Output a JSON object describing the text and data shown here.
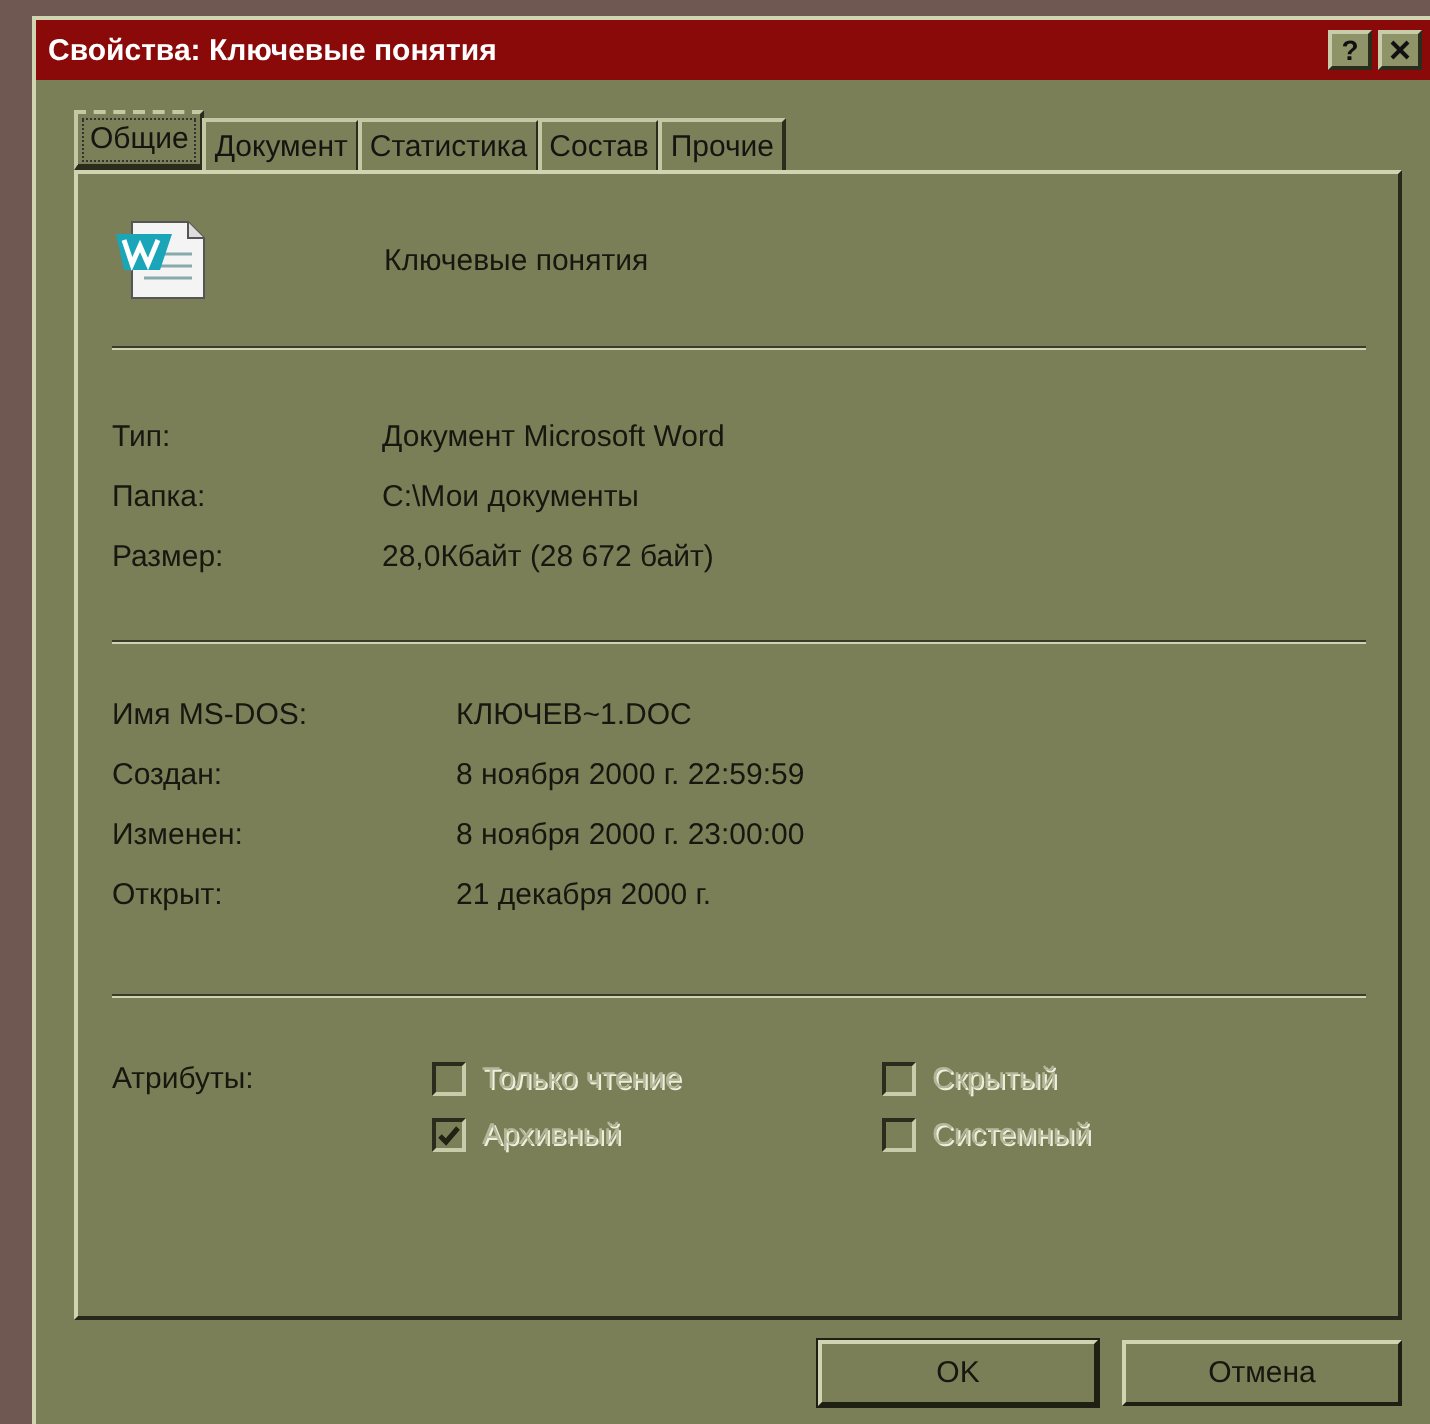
{
  "window": {
    "title": "Свойства: Ключевые понятия",
    "help_button": "?"
  },
  "tabs": [
    {
      "label": "Общие",
      "selected": true
    },
    {
      "label": "Документ",
      "selected": false
    },
    {
      "label": "Статистика",
      "selected": false
    },
    {
      "label": "Состав",
      "selected": false
    },
    {
      "label": "Прочие",
      "selected": false
    }
  ],
  "file": {
    "name": "Ключевые понятия"
  },
  "details": [
    {
      "label": "Тип:",
      "value": "Документ Microsoft Word"
    },
    {
      "label": "Папка:",
      "value": "C:\\Мои документы"
    },
    {
      "label": "Размер:",
      "value": "28,0Кбайт (28 672 байт)"
    }
  ],
  "dos_details": [
    {
      "label": "Имя MS-DOS:",
      "value": "КЛЮЧЕВ~1.DOC"
    },
    {
      "label": "Создан:",
      "value": "8 ноября 2000 г. 22:59:59"
    },
    {
      "label": "Изменен:",
      "value": "8 ноября 2000 г. 23:00:00"
    },
    {
      "label": "Открыт:",
      "value": "21 декабря 2000 г."
    }
  ],
  "attributes": {
    "label": "Атрибуты:",
    "items": [
      {
        "label": "Только чтение",
        "checked": false,
        "disabled": true
      },
      {
        "label": "Скрытый",
        "checked": false,
        "disabled": true
      },
      {
        "label": "Архивный",
        "checked": true,
        "disabled": true
      },
      {
        "label": "Системный",
        "checked": false,
        "disabled": true
      }
    ]
  },
  "buttons": [
    {
      "label": "OK"
    },
    {
      "label": "Отмена"
    }
  ]
}
